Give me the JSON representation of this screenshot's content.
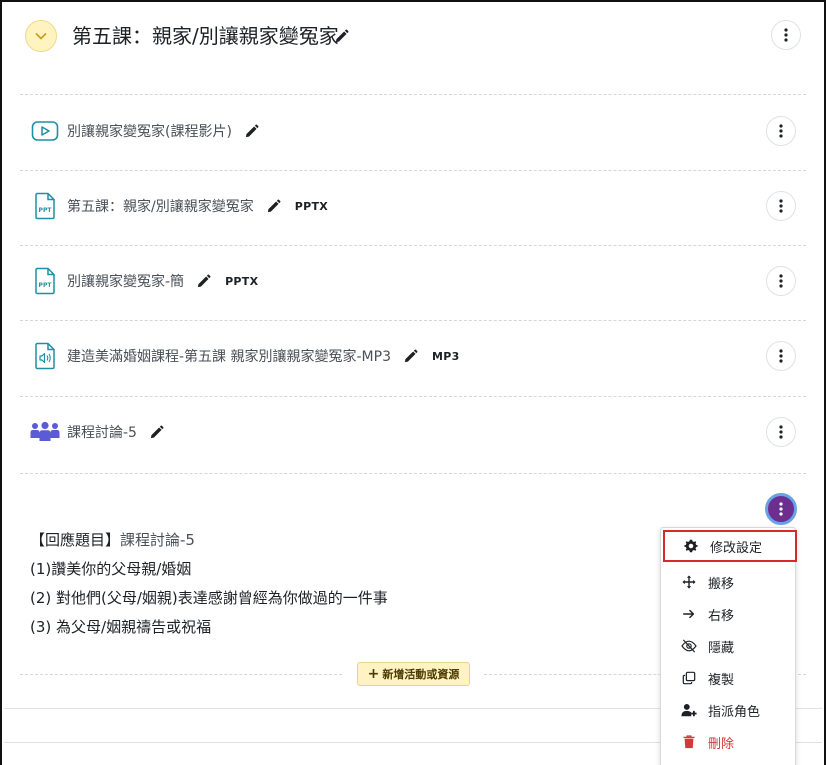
{
  "section": {
    "title": "第五課：親家/別讓親家變冤家"
  },
  "activities": [
    {
      "name": "別讓親家變冤家(課程影片)",
      "icon": "video-play-icon",
      "badge": ""
    },
    {
      "name": "第五課：親家/別讓親家變冤家",
      "icon": "ppt-file-icon",
      "badge": "PPTX"
    },
    {
      "name": "別讓親家變冤家-簡",
      "icon": "ppt-file-icon",
      "badge": "PPTX"
    },
    {
      "name": "建造美滿婚姻課程-第五課 親家別讓親家變冤家-MP3",
      "icon": "audio-file-icon",
      "badge": "MP3"
    },
    {
      "name": "課程討論-5",
      "icon": "forum-people-icon",
      "badge": ""
    }
  ],
  "description": {
    "line1_prefix": "【回應題目】",
    "line1_link": "課程討論-5",
    "line2": "(1)讚美你的父母親/婚姻",
    "line3": "(2) 對他們(父母/姻親)表達感謝曾經為你做過的一件事",
    "line4": "(3) 為父母/姻親禱告或祝福"
  },
  "add_activity": {
    "label": "新增活動或資源"
  },
  "menu": {
    "items": [
      {
        "label": "修改設定",
        "icon": "gear-icon"
      },
      {
        "label": "搬移",
        "icon": "move-arrows-icon"
      },
      {
        "label": "右移",
        "icon": "arrow-right-icon"
      },
      {
        "label": "隱藏",
        "icon": "eye-slash-icon"
      },
      {
        "label": "複製",
        "icon": "copy-icon"
      },
      {
        "label": "指派角色",
        "icon": "user-assign-icon"
      },
      {
        "label": "刪除",
        "icon": "trash-icon"
      }
    ]
  },
  "colors": {
    "accent_yellow": "#fff3bf",
    "active_kebab": "#6c2f8f",
    "file_icon_teal": "#1f8fa6",
    "forum_icon_purple": "#5b5bd6",
    "danger_red": "#d13a3a",
    "highlight_border": "#d62a2a"
  }
}
